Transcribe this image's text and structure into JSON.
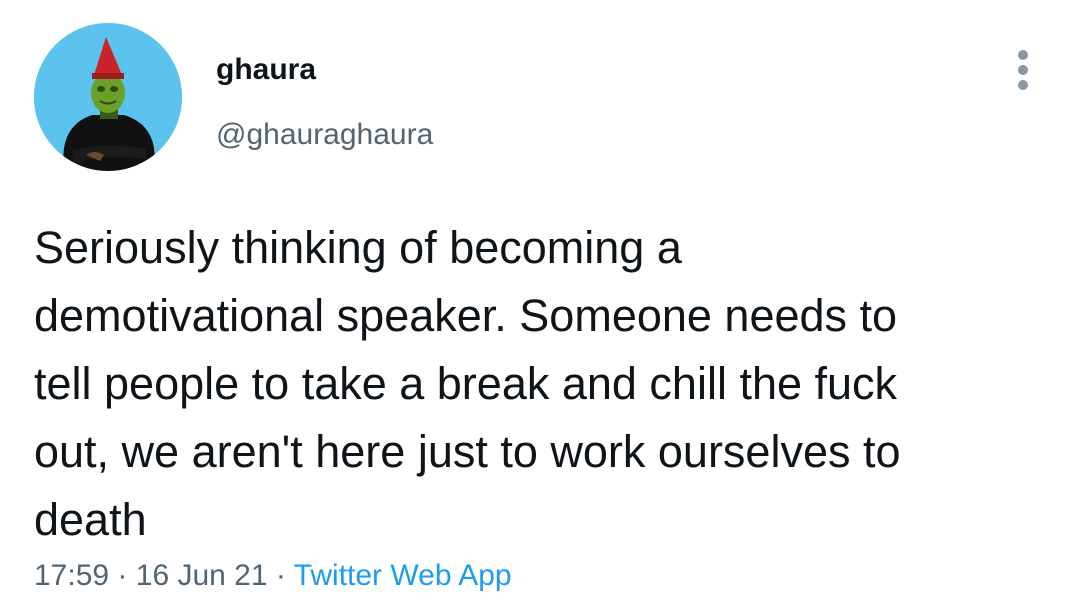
{
  "user": {
    "display_name": "ghaura",
    "handle": "@ghauraghaura"
  },
  "tweet": {
    "text_lines": [
      "Seriously thinking of becoming a",
      "demotivational speaker. Someone needs to",
      "tell people to take a break and chill the fuck",
      "out, we aren't here just to work ourselves to",
      "death"
    ],
    "time": "17:59",
    "separator": "·",
    "date": "16 Jun 21",
    "source": "Twitter Web App"
  },
  "colors": {
    "avatar_background": "#5bc3ee",
    "link": "#1d9bf0",
    "secondary_text": "#536471",
    "primary_text": "#0f1419"
  },
  "icons": {
    "more": "more-vertical-icon"
  }
}
